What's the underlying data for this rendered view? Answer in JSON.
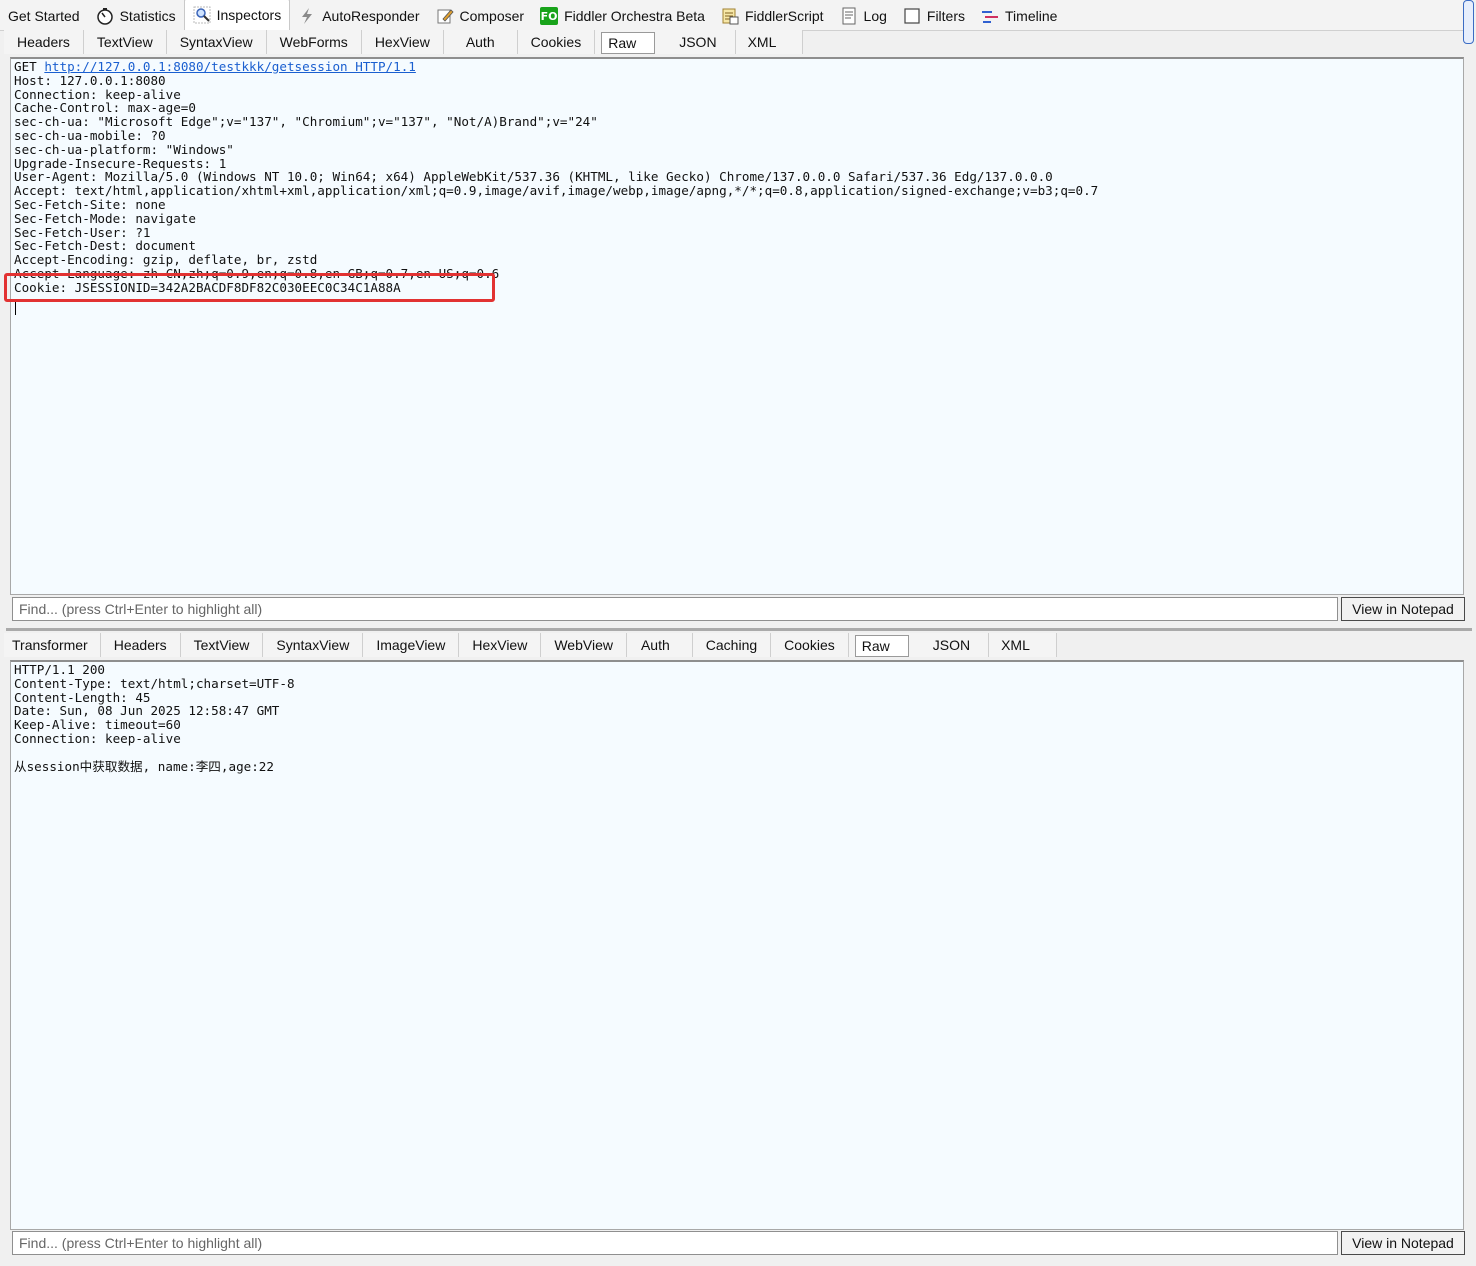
{
  "main_tabs": [
    {
      "label": "Get Started",
      "icon": "none"
    },
    {
      "label": "Statistics",
      "icon": "stopwatch-icon"
    },
    {
      "label": "Inspectors",
      "icon": "magnifier-icon"
    },
    {
      "label": "AutoResponder",
      "icon": "lightning-icon"
    },
    {
      "label": "Composer",
      "icon": "pencil-icon"
    },
    {
      "label": "Fiddler Orchestra Beta",
      "icon": "fo-icon",
      "icon_text": "FO"
    },
    {
      "label": "FiddlerScript",
      "icon": "script-icon"
    },
    {
      "label": "Log",
      "icon": "log-icon"
    },
    {
      "label": "Filters",
      "icon": "checkbox-icon"
    },
    {
      "label": "Timeline",
      "icon": "timeline-icon"
    }
  ],
  "request": {
    "tabs": [
      "Headers",
      "TextView",
      "SyntaxView",
      "WebForms",
      "HexView",
      "Auth",
      "Cookies",
      "Raw",
      "JSON",
      "XML"
    ],
    "active_tab": "Raw",
    "request_line_method": "GET ",
    "request_line_url": "http://127.0.0.1:8080/testkkk/getsession HTTP/1.1",
    "headers_text": "Host: 127.0.0.1:8080\nConnection: keep-alive\nCache-Control: max-age=0\nsec-ch-ua: \"Microsoft Edge\";v=\"137\", \"Chromium\";v=\"137\", \"Not/A)Brand\";v=\"24\"\nsec-ch-ua-mobile: ?0\nsec-ch-ua-platform: \"Windows\"\nUpgrade-Insecure-Requests: 1\nUser-Agent: Mozilla/5.0 (Windows NT 10.0; Win64; x64) AppleWebKit/537.36 (KHTML, like Gecko) Chrome/137.0.0.0 Safari/537.36 Edg/137.0.0.0\nAccept: text/html,application/xhtml+xml,application/xml;q=0.9,image/avif,image/webp,image/apng,*/*;q=0.8,application/signed-exchange;v=b3;q=0.7\nSec-Fetch-Site: none\nSec-Fetch-Mode: navigate\nSec-Fetch-User: ?1\nSec-Fetch-Dest: document\nAccept-Encoding: gzip, deflate, br, zstd\nAccept-Language: zh-CN,zh;q=0.9,en;q=0.8,en-GB;q=0.7,en-US;q=0.6\nCookie: JSESSIONID=342A2BACDF8DF82C030EEC0C34C1A88A\n",
    "find_placeholder": "Find... (press Ctrl+Enter to highlight all)",
    "notepad_label": "View in Notepad",
    "highlight_color": "#e23232"
  },
  "response": {
    "tabs": [
      "Transformer",
      "Headers",
      "TextView",
      "SyntaxView",
      "ImageView",
      "HexView",
      "WebView",
      "Auth",
      "Caching",
      "Cookies",
      "Raw",
      "JSON",
      "XML"
    ],
    "active_tab": "Raw",
    "raw_text": "HTTP/1.1 200\nContent-Type: text/html;charset=UTF-8\nContent-Length: 45\nDate: Sun, 08 Jun 2025 12:58:47 GMT\nKeep-Alive: timeout=60\nConnection: keep-alive\n\n从session中获取数据, name:李四,age:22",
    "find_placeholder": "Find... (press Ctrl+Enter to highlight all)",
    "notepad_label": "View in Notepad"
  }
}
